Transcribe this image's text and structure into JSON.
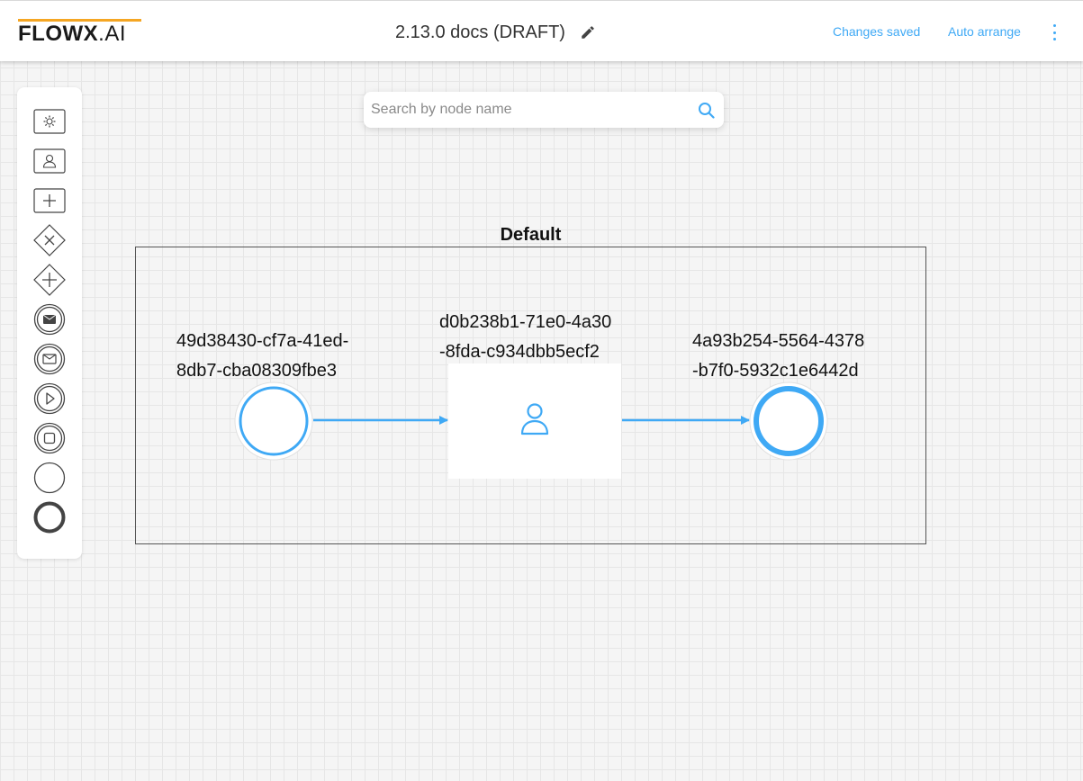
{
  "header": {
    "logo_bold": "FLOWX",
    "logo_light": ".AI",
    "title": "2.13.0 docs (DRAFT)",
    "status": "Changes saved",
    "auto_arrange": "Auto arrange",
    "more_icon": "kebab-menu-icon",
    "edit_icon": "pencil-icon"
  },
  "search": {
    "placeholder": "Search by node name",
    "icon": "search-icon"
  },
  "palette": {
    "tools": [
      "gear-icon",
      "user-task-icon",
      "subprocess-icon",
      "exclusive-gateway-icon",
      "parallel-gateway-icon",
      "message-send-icon",
      "message-receive-icon",
      "start-subprocess-icon",
      "end-subprocess-icon",
      "start-event-icon",
      "end-event-icon"
    ]
  },
  "lane": {
    "title": "Default"
  },
  "nodes": {
    "start": {
      "label_line1": "49d38430-cf7a-41ed-",
      "label_line2": "8db7-cba08309fbe3"
    },
    "task": {
      "label_line1": "d0b238b1-71e0-4a30",
      "label_line2": "-8fda-c934dbb5ecf2",
      "icon": "user-icon"
    },
    "end": {
      "label_line1": "4a93b254-5564-4378",
      "label_line2": "-b7f0-5932c1e6442d"
    }
  },
  "colors": {
    "accent": "#3fa9f5",
    "logo_bar": "#f5a623",
    "text": "#111111",
    "header_bg": "#ffffff",
    "canvas_bg": "#f5f5f5"
  }
}
